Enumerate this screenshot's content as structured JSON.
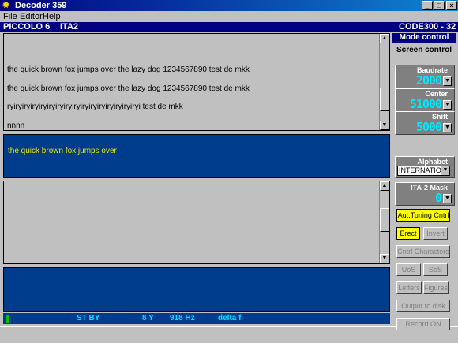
{
  "window": {
    "title": "Decoder 359",
    "min": "_",
    "max": "□",
    "close": "×"
  },
  "menu": {
    "file": "File",
    "editor": "Editor",
    "help": "Help"
  },
  "infobar": {
    "station": "PICCOLO 6",
    "mode": "ITA2",
    "code": "CODE300 - 32"
  },
  "receive": {
    "lines": [
      "the quick brown fox jumps over the lazy dog 1234567890 test de mkk",
      "the quick brown fox jumps over the lazy dog 1234567890 test de mkk",
      "ryiryiryiryiryiryiryiryiryiryiryiryiryiryiryiryi test de mkk",
      "nnnn"
    ]
  },
  "transmit": {
    "text": "the quick brown fox jumps over"
  },
  "status": {
    "state": "ST BY",
    "bits": "8 Y",
    "freq": "918 Hz",
    "delta": "delta f"
  },
  "panel": {
    "mode_control": "Mode control",
    "screen_control": "Screen control",
    "baudrate_label": "Baudrate",
    "baudrate_value": "2000",
    "center_label": "Center",
    "center_value": "51000",
    "shift_label": "Shift",
    "shift_value": "5000",
    "alphabet_label": "Alphabet",
    "alphabet_value": "INTERNATION",
    "mask_label": "ITA-2 Mask",
    "mask_value": "0",
    "aut_tuning": "Aut.Tuning Cntrl",
    "erect": "Erect",
    "invert": "Invert",
    "cntrl_chars": "Cntrl Characters",
    "uos": "UoS",
    "sos": "SoS",
    "letters": "Letters",
    "figures": "Figures",
    "output_disk": "Output to disk",
    "record": "Record ON"
  },
  "colors": {
    "accent": "#000080",
    "pane_blue": "#003c8c",
    "active_button": "#ffff00",
    "digits": "#00e8ff"
  }
}
